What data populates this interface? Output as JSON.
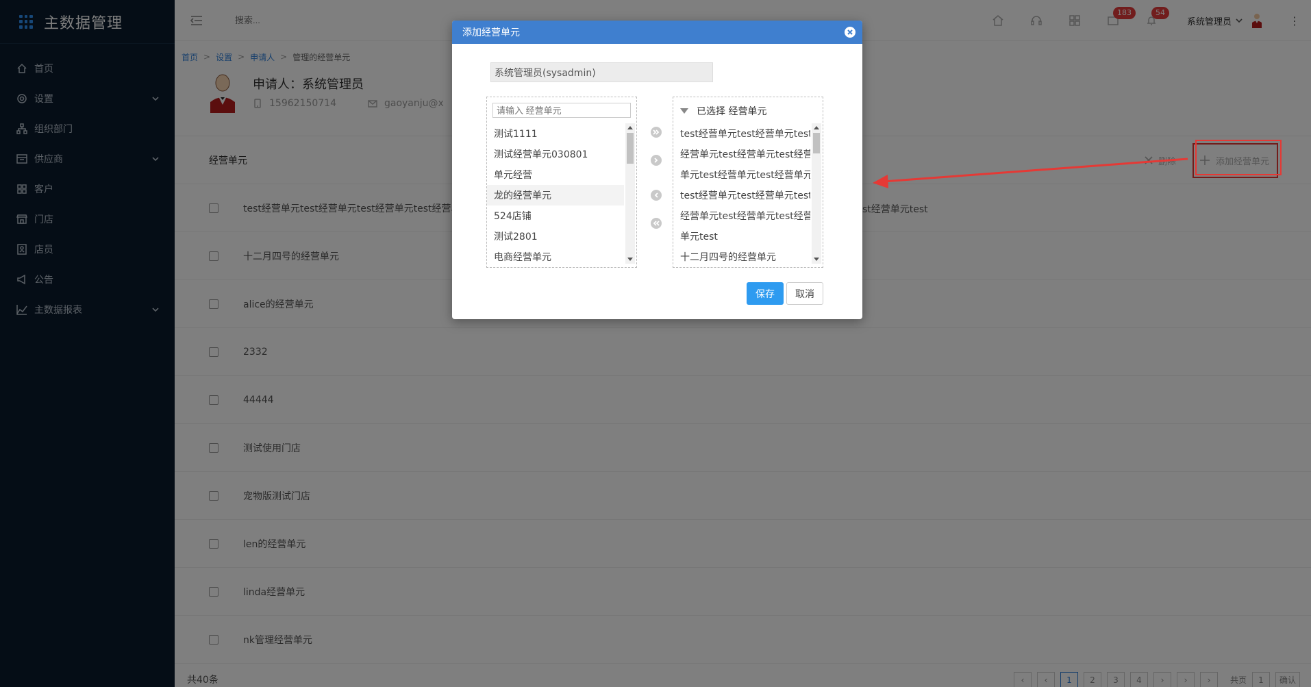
{
  "app": {
    "title": "主数据管理"
  },
  "sidebar": {
    "items": [
      {
        "label": "首页",
        "icon": "home-icon",
        "has_caret": false
      },
      {
        "label": "设置",
        "icon": "gear-icon",
        "has_caret": true
      },
      {
        "label": "组织部门",
        "icon": "org-chart-icon",
        "has_caret": false
      },
      {
        "label": "供应商",
        "icon": "supplier-icon",
        "has_caret": true
      },
      {
        "label": "客户",
        "icon": "customer-icon",
        "has_caret": false
      },
      {
        "label": "门店",
        "icon": "store-icon",
        "has_caret": false
      },
      {
        "label": "店员",
        "icon": "clerk-icon",
        "has_caret": false
      },
      {
        "label": "公告",
        "icon": "announcement-icon",
        "has_caret": false
      },
      {
        "label": "主数据报表",
        "icon": "chart-line-icon",
        "has_caret": true
      }
    ]
  },
  "topbar": {
    "search_placeholder": "搜索...",
    "icons": [
      "home-icon",
      "headset-icon",
      "apps-grid-icon",
      "message-icon",
      "bell-icon"
    ],
    "message_badge": "183",
    "bell_badge": "54",
    "user_name": "系统管理员"
  },
  "breadcrumb": {
    "home": "首页",
    "settings": "设置",
    "applicant": "申请人",
    "current": "管理的经营单元",
    "separator": ">"
  },
  "profile": {
    "title": "申请人：系统管理员",
    "phone": "15962150714",
    "email": "gaoyanju@x"
  },
  "units": {
    "header": "经营单元",
    "delete_label": "删除",
    "add_label": "添加经营单元",
    "rows": [
      "test经营单元test经营单元test经营单元test经营单",
      "十二月四号的经营单元",
      "alice的经营单元",
      "2332",
      "44444",
      "测试使用门店",
      "宠物版测试门店",
      "len的经营单元",
      "linda经营单元",
      "nk管理经营单元"
    ],
    "row1_tail": "st经营单元test",
    "total": "共40条"
  },
  "pager": {
    "pages": [
      "1",
      "2",
      "3",
      "4"
    ],
    "current_page": "1",
    "total_pages_label": "共页",
    "jump_page": "1",
    "confirm_label": "确认"
  },
  "modal": {
    "title": "添加经营单元",
    "owner_value": "系统管理员(sysadmin)",
    "search_placeholder": "请输入 经营单元",
    "source_items": [
      "测试1111",
      "测试经营单元030801",
      "单元经营",
      "龙的经营单元",
      "524店铺",
      "测试2801",
      "电商经营单元"
    ],
    "target_header": "已选择 经营单元",
    "target_items": [
      "test经营单元test经营单元test",
      "经营单元test经营单元test经营",
      "单元test经营单元test经营单元",
      "test经营单元test经营单元test",
      "经营单元test经营单元test经营",
      "单元test",
      "十二月四号的经营单元"
    ],
    "save_label": "保存",
    "cancel_label": "取消"
  },
  "colors": {
    "sidebar_bg": "#0a1a2c",
    "accent": "#2e7fd8",
    "modal_header": "#3f7fcf",
    "save_button": "#2e9bf0",
    "annotation_red": "#e53935",
    "badge_red": "#e23b3b"
  }
}
